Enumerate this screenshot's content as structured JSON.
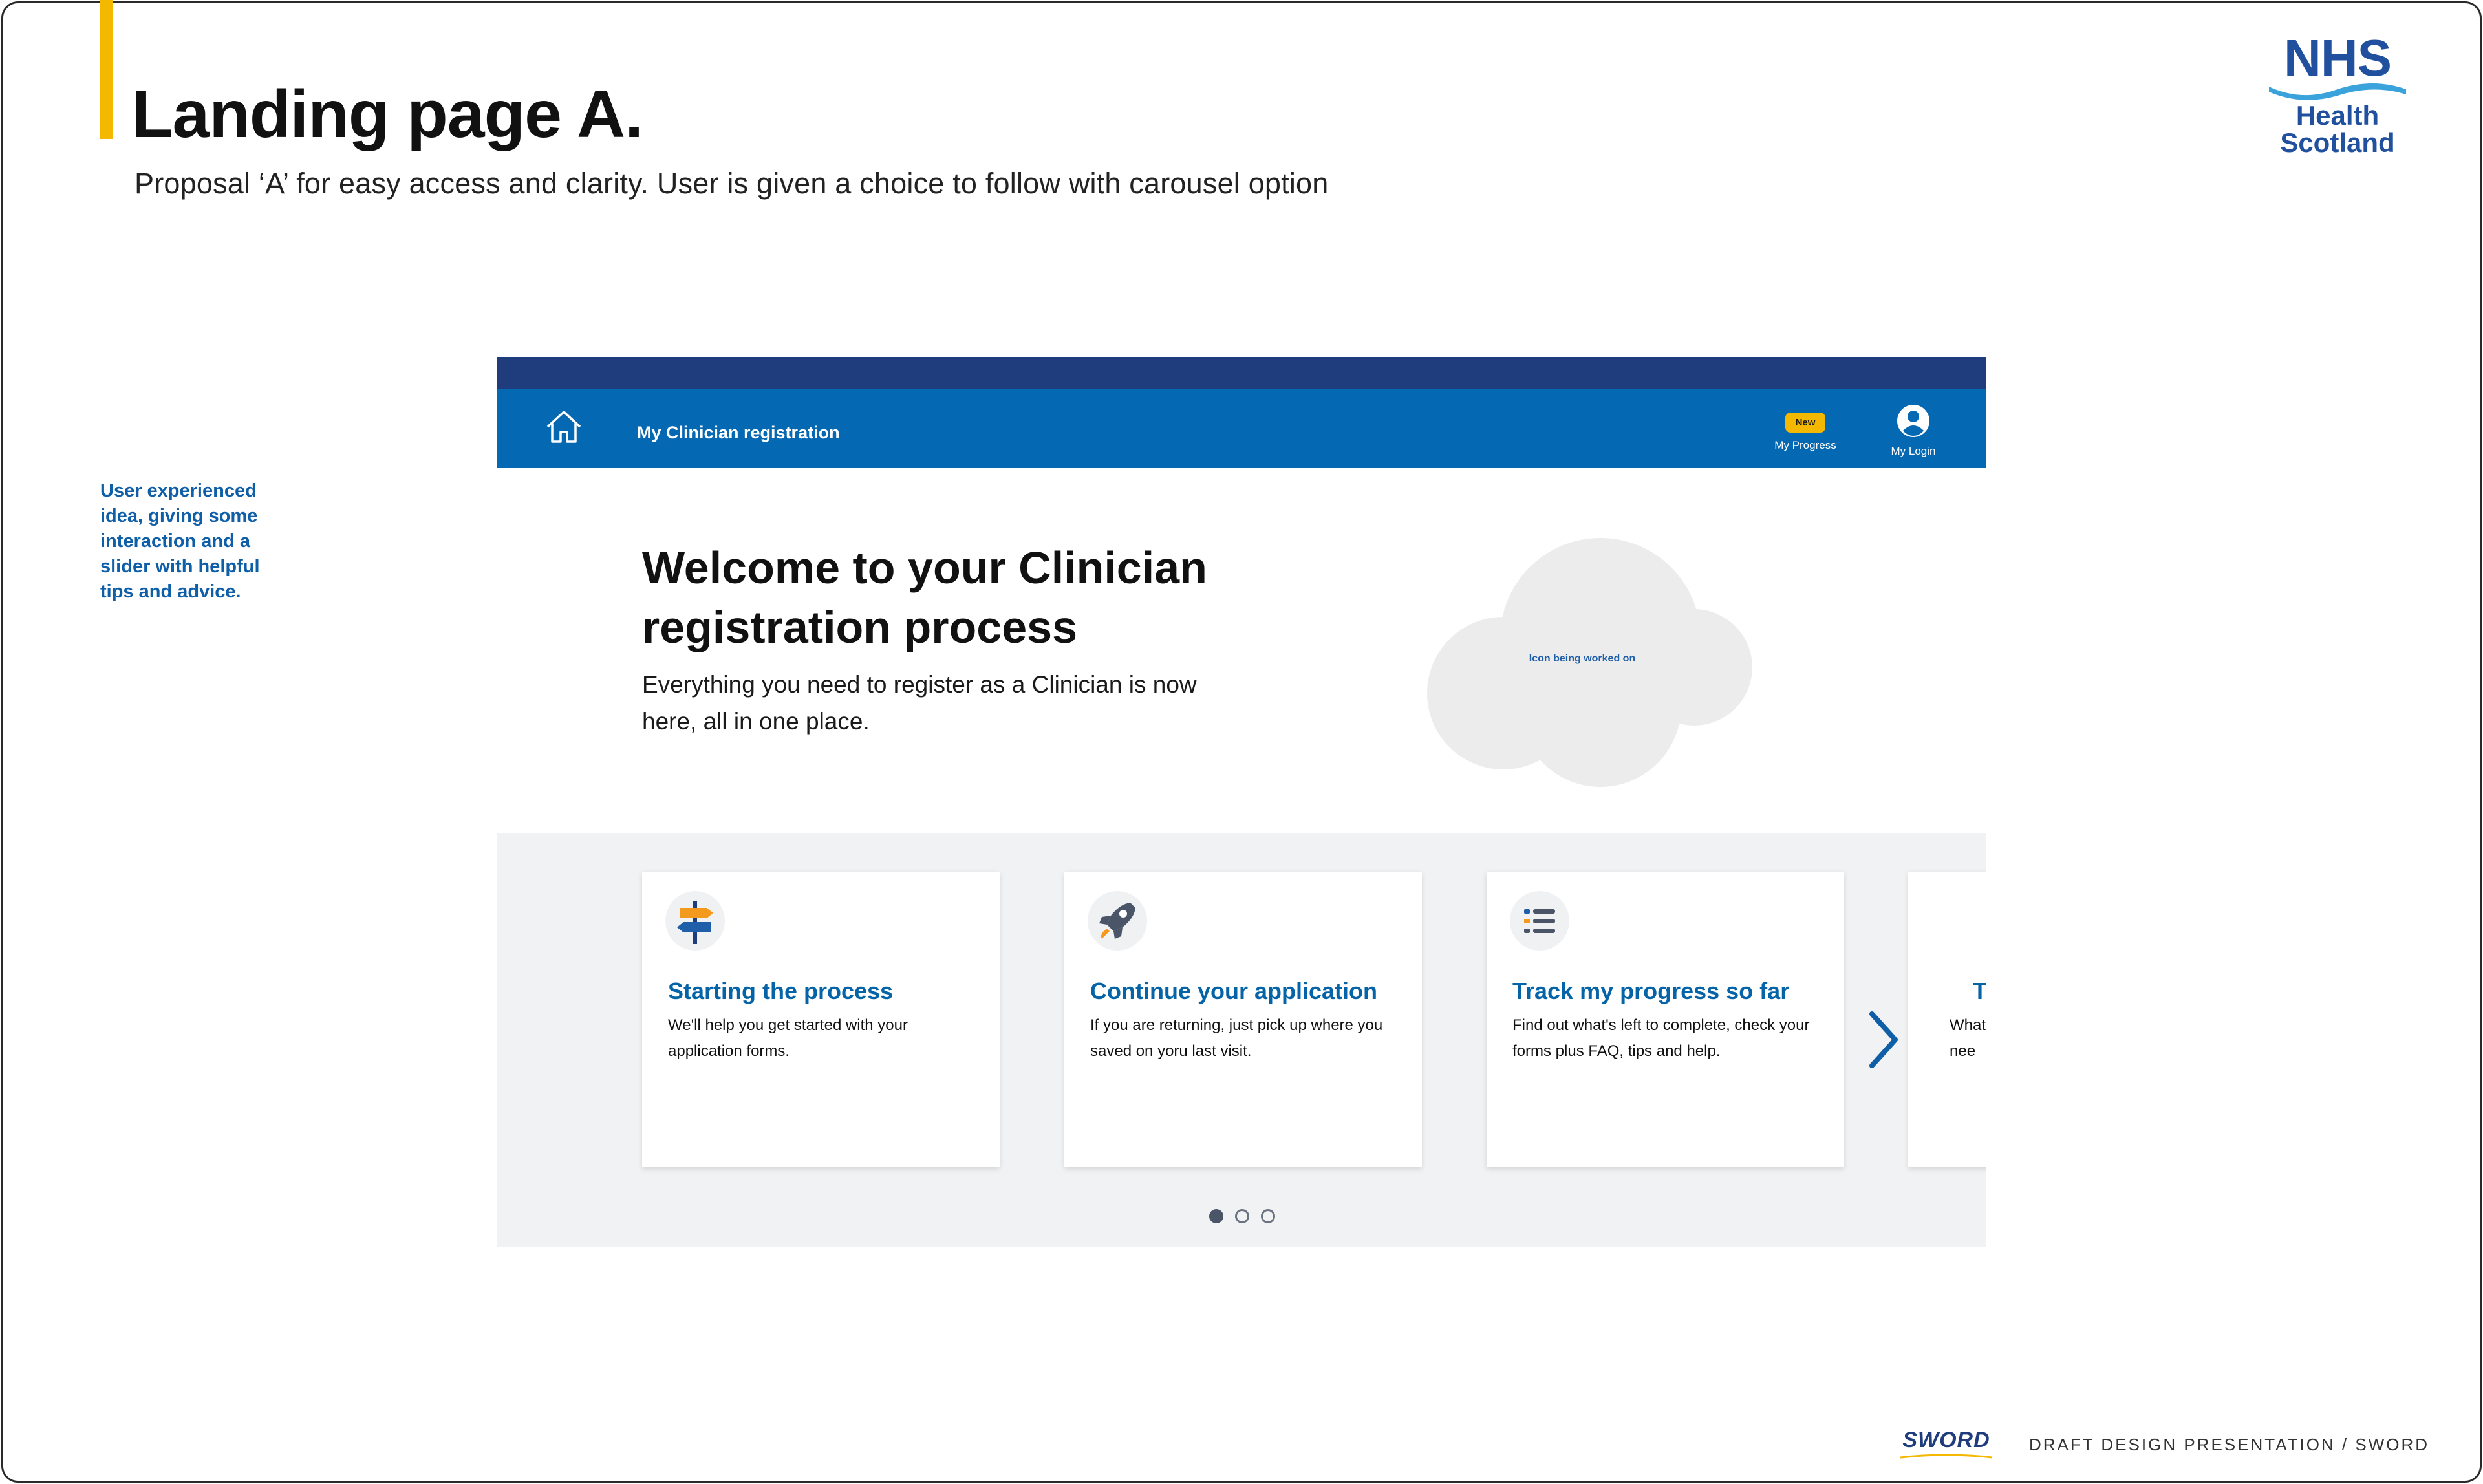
{
  "slide": {
    "title": "Landing page A.",
    "subtitle": "Proposal ‘A’ for easy access and clarity. User is given a choice to follow with carousel option",
    "side_note": "User experienced idea, giving some interaction and a slider with helpful tips and advice.",
    "footer": "DRAFT DESIGN PRESENTATION / SWORD",
    "accent_color": "#f5b800"
  },
  "brand_logo": {
    "word": "NHS",
    "line1": "Health",
    "line2": "Scotland",
    "color": "#21509e"
  },
  "footer_logo": {
    "word": "SWORD",
    "icon": "sword-logo"
  },
  "mockup": {
    "navbar": {
      "home_icon": "home-icon",
      "title": "My Clinician registration",
      "progress_badge": "New",
      "progress_label": "My Progress",
      "login_label": "My Login",
      "login_icon": "user-circle-icon",
      "color_dark": "#1f3d7c",
      "color": "#0568b3"
    },
    "hero": {
      "title": "Welcome to your Clinician registration process",
      "text": "Everything you need to register as a Clinician is now here, all in one place.",
      "placeholder_label": "Icon being worked on"
    },
    "carousel": {
      "cards": [
        {
          "icon": "signpost-icon",
          "title": "Starting the process",
          "text": "We'll help you get started with your application forms."
        },
        {
          "icon": "rocket-icon",
          "title": "Continue your application",
          "text": "If you are returning, just pick up where you saved on yoru last visit."
        },
        {
          "icon": "checklist-icon",
          "title": "Track my progress so far",
          "text": "Find out what's left to complete, check your forms plus FAQ, tips and help."
        },
        {
          "icon": "partial-card",
          "title": "Tr",
          "text": "What' nee"
        }
      ],
      "next_icon": "chevron-right-icon",
      "pages": 3,
      "active_page": 1
    }
  }
}
